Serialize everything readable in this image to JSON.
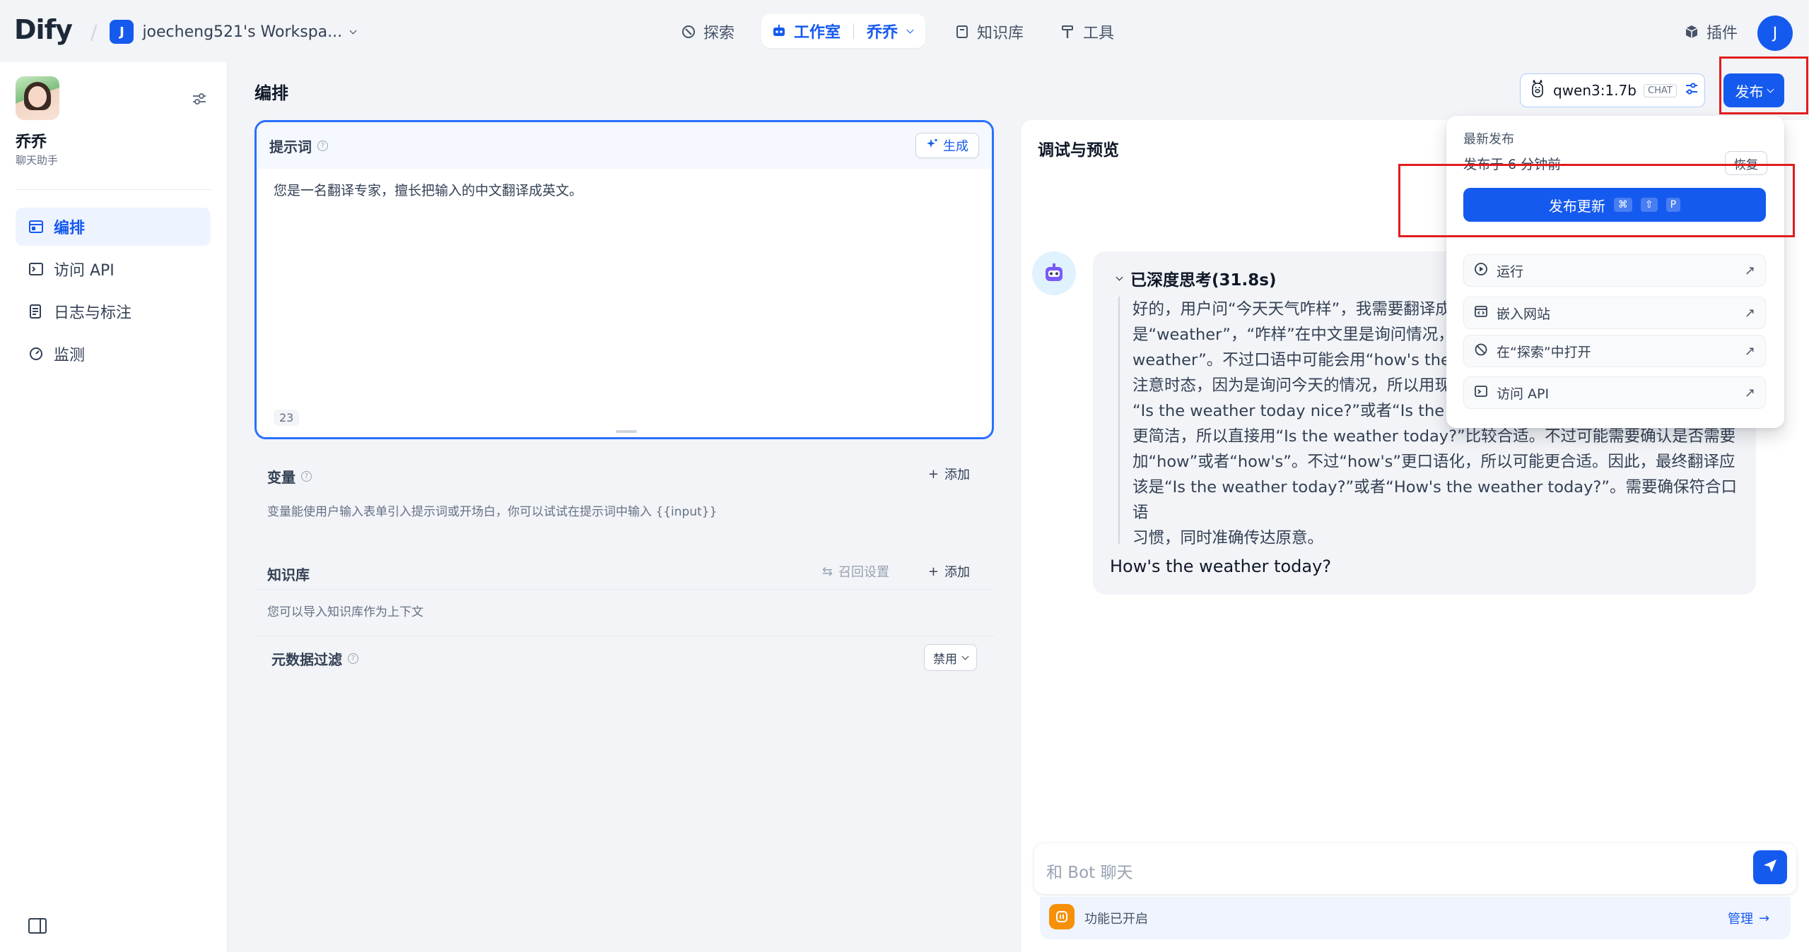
{
  "brand": {
    "logo": "Dify"
  },
  "workspace": {
    "initial": "J",
    "name": "joecheng521's Workspa..."
  },
  "nav": {
    "explore": "探索",
    "studio": "工作室",
    "current_app": "乔乔",
    "knowledge": "知识库",
    "tools": "工具",
    "plugins": "插件",
    "user_initial": "J"
  },
  "app": {
    "name": "乔乔",
    "type": "聊天助手"
  },
  "sidebar": {
    "items": [
      {
        "label": "编排",
        "icon": "layout-icon",
        "active": true
      },
      {
        "label": "访问 API",
        "icon": "terminal-icon",
        "active": false
      },
      {
        "label": "日志与标注",
        "icon": "file-list-icon",
        "active": false
      },
      {
        "label": "监测",
        "icon": "dashboard-icon",
        "active": false
      }
    ]
  },
  "main": {
    "title": "编排",
    "prompt": {
      "title": "提示词",
      "generate_label": "生成",
      "text": "您是一名翻译专家，擅长把输入的中文翻译成英文。",
      "char_count": "23"
    },
    "variables": {
      "title": "变量",
      "add_label": "添加",
      "description": "变量能使用户输入表单引入提示词或开场白，你可以试试在提示词中输入 {{input}}"
    },
    "knowledge": {
      "title": "知识库",
      "recall_label": "召回设置",
      "add_label": "添加",
      "description": "您可以导入知识库作为上下文"
    },
    "metadata_filter": {
      "title": "元数据过滤",
      "value": "禁用"
    }
  },
  "header_right": {
    "model_name": "qwen3:1.7b",
    "model_badge": "CHAT",
    "publish_label": "发布"
  },
  "publish_menu": {
    "latest_label": "最新发布",
    "published_time": "发布于 6 分钟前",
    "restore_label": "恢复",
    "update_label": "发布更新",
    "shortcut": [
      "⌘",
      "⇧",
      "P"
    ],
    "items": [
      {
        "label": "运行",
        "icon": "play-circle-icon"
      },
      {
        "label": "嵌入网站",
        "icon": "embed-icon"
      },
      {
        "label": "在“探索”中打开",
        "icon": "explore-icon"
      },
      {
        "label": "访问 API",
        "icon": "terminal-icon"
      }
    ]
  },
  "debug": {
    "title": "调试与预览",
    "thinking_label": "已深度思考(31.8s)",
    "thinking_lines": [
      "好的，用户问“今天天气咋样”，我需要翻译成",
      "是“weather”，“咋样”在中文里是询问情况，这",
      "weather”。不过口语中可能会用“how's the w",
      "注意时态，因为是询问今天的情况，所以用现",
      "“Is the weather today nice?”或者“Is the we",
      "更简洁，所以直接用“Is the weather today?”比较合适。不过可能需要确认是否需要",
      "加“how”或者“how's”。不过“how's”更口语化，所以可能更合适。因此，最终翻译应",
      "该是“Is the weather today?”或者“How's the weather today?”。需要确保符合口语",
      "习惯，同时准确传达原意。"
    ],
    "answer": "How's the weather today?",
    "input_placeholder": "和 Bot 聊天",
    "features_label": "功能已开启",
    "manage_label": "管理"
  },
  "colors": {
    "accent": "#155aef",
    "highlight": "#e11d1d",
    "feature_icon": "#f79009"
  }
}
